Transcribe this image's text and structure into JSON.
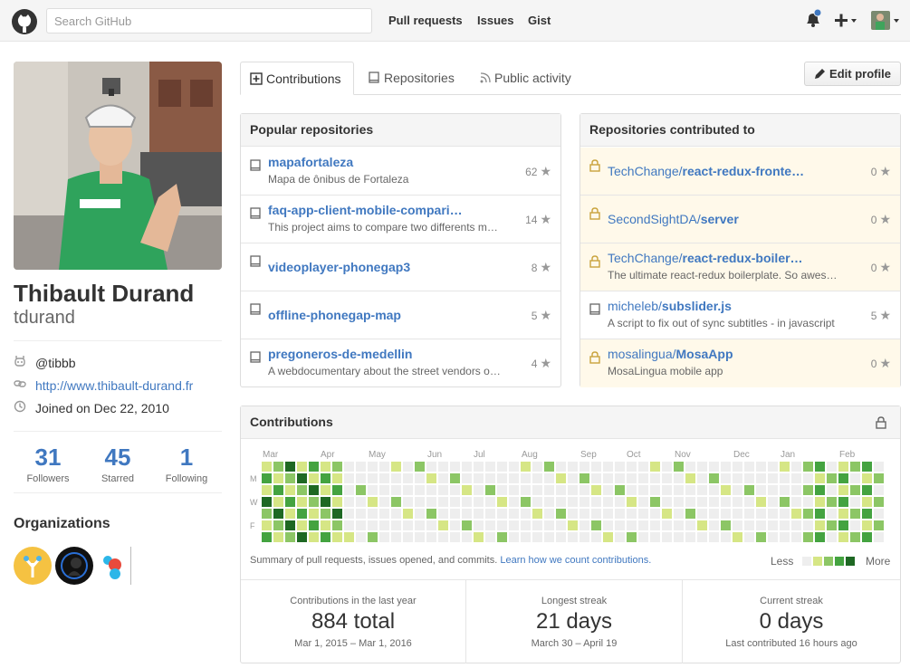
{
  "header": {
    "search_placeholder": "Search GitHub",
    "nav": [
      "Pull requests",
      "Issues",
      "Gist"
    ],
    "icons": [
      "github-logo-icon",
      "bell-icon",
      "plus-icon",
      "avatar-icon"
    ]
  },
  "profile": {
    "full_name": "Thibault Durand",
    "username": "tdurand",
    "twitter": "@tibbb",
    "website": "http://www.thibault-durand.fr",
    "joined": "Joined on Dec 22, 2010",
    "stats": [
      {
        "value": "31",
        "label": "Followers"
      },
      {
        "value": "45",
        "label": "Starred"
      },
      {
        "value": "1",
        "label": "Following"
      }
    ],
    "organizations_title": "Organizations"
  },
  "tabs": {
    "contributions": "Contributions",
    "repositories": "Repositories",
    "public_activity": "Public activity",
    "edit_profile": "Edit profile"
  },
  "popular": {
    "title": "Popular repositories",
    "repos": [
      {
        "name": "mapafortaleza",
        "description": "Mapa de ônibus de Fortaleza",
        "stars": "62"
      },
      {
        "name": "faq-app-client-mobile-compari…",
        "description": "This project aims to compare two differents m…",
        "stars": "14"
      },
      {
        "name": "videoplayer-phonegap3",
        "description": "",
        "stars": "8"
      },
      {
        "name": "offline-phonegap-map",
        "description": "",
        "stars": "5"
      },
      {
        "name": "pregoneros-de-medellin",
        "description": "A webdocumentary about the street vendors o…",
        "stars": "4"
      }
    ]
  },
  "contributed": {
    "title": "Repositories contributed to",
    "repos": [
      {
        "owner": "TechChange/",
        "name": "react-redux-fronte…",
        "description": "",
        "stars": "0",
        "private": true
      },
      {
        "owner": "SecondSightDA/",
        "name": "server",
        "description": "",
        "stars": "0",
        "private": true
      },
      {
        "owner": "TechChange/",
        "name": "react-redux-boiler…",
        "description": "The ultimate react-redux boilerplate. So awes…",
        "stars": "0",
        "private": true
      },
      {
        "owner": "micheleb/",
        "name": "subslider.js",
        "description": "A script to fix out of sync subtitles - in javascript",
        "stars": "5",
        "private": false
      },
      {
        "owner": "mosalingua/",
        "name": "MosaApp",
        "description": "MosaLingua mobile app",
        "stars": "0",
        "private": true
      }
    ]
  },
  "contributions": {
    "title": "Contributions",
    "months": [
      "Mar",
      "Apr",
      "May",
      "Jun",
      "Jul",
      "Aug",
      "Sep",
      "Oct",
      "Nov",
      "Dec",
      "Jan",
      "Feb"
    ],
    "days": [
      "M",
      "W",
      "F"
    ],
    "summary": "Summary of pull requests, issues opened, and commits.",
    "learn_link": "Learn how we count contributions.",
    "legend_less": "Less",
    "legend_more": "More",
    "colors": [
      "#eeeeee",
      "#d6e685",
      "#8cc665",
      "#44a340",
      "#1e6823"
    ],
    "stats": [
      {
        "label": "Contributions in the last year",
        "value": "884 total",
        "detail": "Mar 1, 2015 – Mar 1, 2016"
      },
      {
        "label": "Longest streak",
        "value": "21 days",
        "detail": "March 30 – April 19"
      },
      {
        "label": "Current streak",
        "value": "0 days",
        "detail": "Last contributed 16 hours ago"
      }
    ]
  }
}
